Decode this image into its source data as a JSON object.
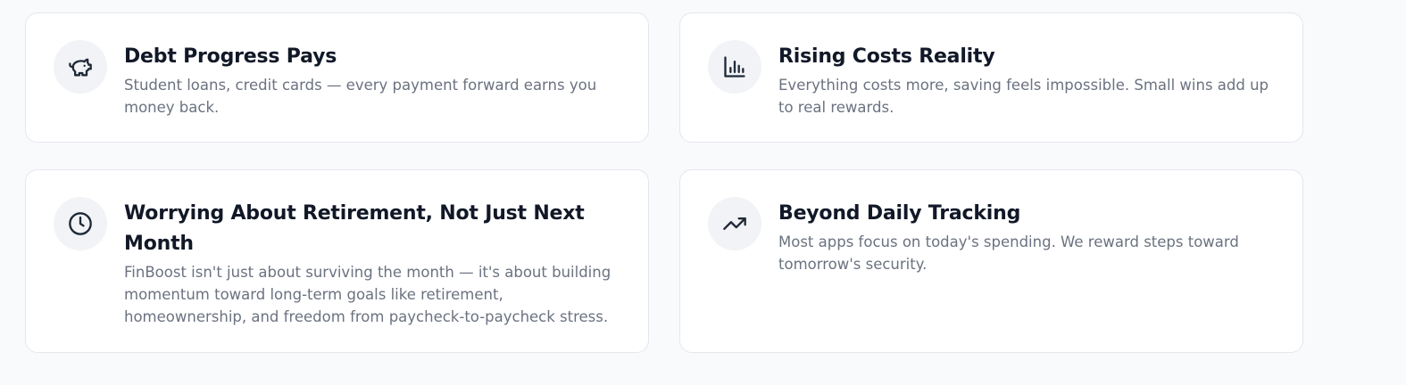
{
  "cards": [
    {
      "icon": "piggy-bank-icon",
      "title": "Debt Progress Pays",
      "description": "Student loans, credit cards — every payment forward earns you money back."
    },
    {
      "icon": "bar-chart-icon",
      "title": "Rising Costs Reality",
      "description": "Everything costs more, saving feels impossible. Small wins add up to real rewards."
    },
    {
      "icon": "clock-icon",
      "title": "Worrying About Retirement, Not Just Next Month",
      "description": "FinBoost isn't just about surviving the month — it's about building momentum toward long-term goals like retirement, homeownership, and freedom from paycheck-to-paycheck stress."
    },
    {
      "icon": "trending-up-icon",
      "title": "Beyond Daily Tracking",
      "description": "Most apps focus on today's spending. We reward steps toward tomorrow's security."
    }
  ],
  "colors": {
    "background": "#f9fafb",
    "card": "#ffffff",
    "icon_circle": "#f1f3f6",
    "title": "#111827",
    "description": "#6b7280"
  }
}
